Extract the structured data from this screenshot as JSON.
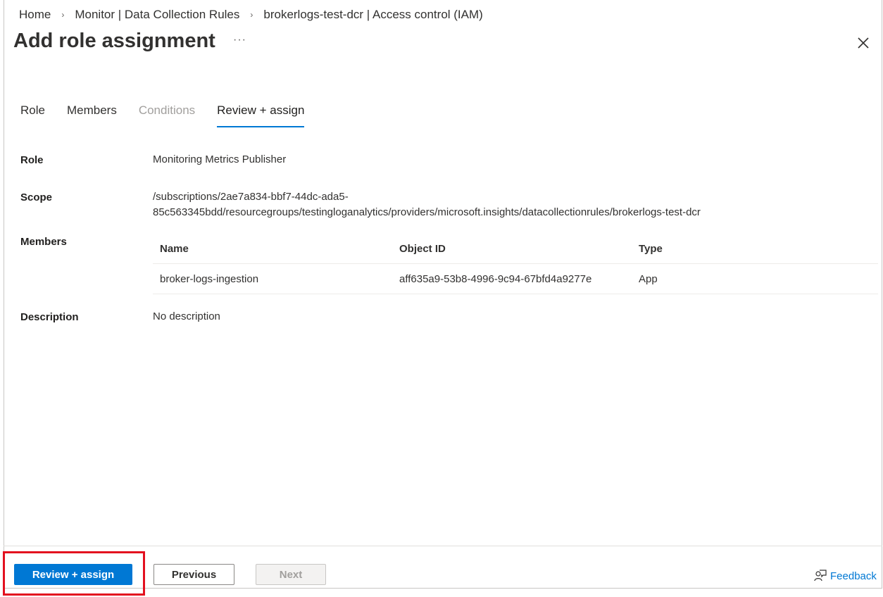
{
  "breadcrumb": {
    "items": [
      "Home",
      "Monitor | Data Collection Rules",
      "brokerlogs-test-dcr | Access control (IAM)"
    ],
    "separator": "›"
  },
  "header": {
    "title": "Add role assignment",
    "more": "···"
  },
  "tabs": [
    {
      "label": "Role",
      "state": "normal"
    },
    {
      "label": "Members",
      "state": "normal"
    },
    {
      "label": "Conditions",
      "state": "disabled"
    },
    {
      "label": "Review + assign",
      "state": "active"
    }
  ],
  "review": {
    "role_label": "Role",
    "role_value": "Monitoring Metrics Publisher",
    "scope_label": "Scope",
    "scope_line1": "/subscriptions/2ae7a834-bbf7-44dc-ada5-",
    "scope_line2": "85c563345bdd/resourcegroups/testingloganalytics/providers/microsoft.insights/datacollectionrules/brokerlogs-test-dcr",
    "members_label": "Members",
    "members_table": {
      "headers": [
        "Name",
        "Object ID",
        "Type"
      ],
      "rows": [
        [
          "broker-logs-ingestion",
          "aff635a9-53b8-4996-9c94-67bfd4a9277e",
          "App"
        ]
      ]
    },
    "description_label": "Description",
    "description_value": "No description"
  },
  "footer": {
    "review_assign_label": "Review + assign",
    "previous_label": "Previous",
    "next_label": "Next",
    "feedback_label": "Feedback"
  },
  "colors": {
    "accent": "#0078d4",
    "highlight": "#e3101f"
  }
}
